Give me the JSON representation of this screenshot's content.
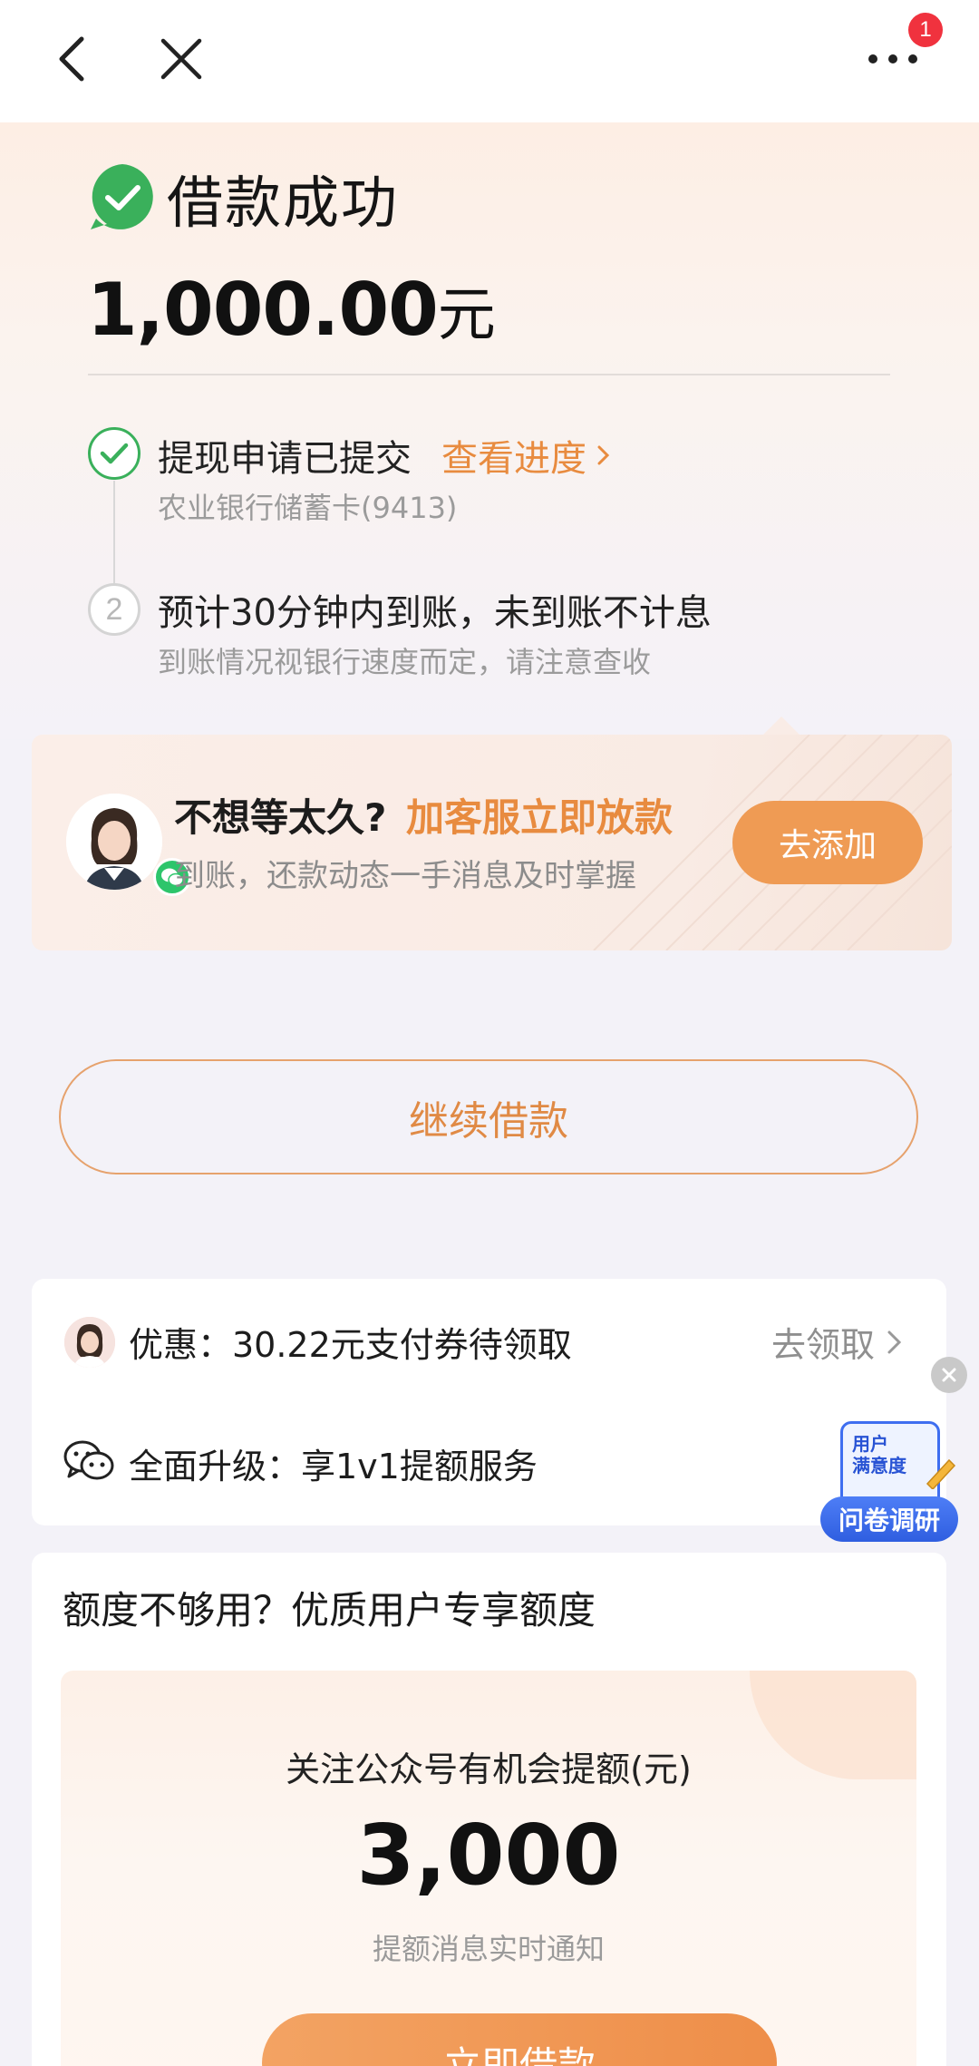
{
  "nav": {
    "back_icon": "chevron-left-icon",
    "close_icon": "close-icon",
    "more_icon": "more-horizontal-icon",
    "badge_count": "1"
  },
  "result": {
    "title": "借款成功",
    "amount": "1,000.00",
    "amount_unit": "元"
  },
  "steps": [
    {
      "title": "提现申请已提交",
      "link": "查看进度",
      "subtitle": "农业银行储蓄卡(9413)",
      "status": "done"
    },
    {
      "number": "2",
      "title": "预计30分钟内到账，未到账不计息",
      "subtitle": "到账情况视银行速度而定，请注意查收",
      "status": "pending"
    }
  ],
  "service_card": {
    "title": "不想等太久?",
    "highlight": "加客服立即放款",
    "subtitle": "到账，还款动态一手消息及时掌握",
    "button": "去添加"
  },
  "continue_button": "继续借款",
  "promos": [
    {
      "text": "优惠：30.22元支付券待领取",
      "action": "去领取"
    },
    {
      "text": "全面升级：享1v1提额服务"
    }
  ],
  "survey": {
    "doc_text_line1": "用户",
    "doc_text_line2": "满意度",
    "label": "问卷调研"
  },
  "limit_card": {
    "title": "额度不够用？优质用户专享额度",
    "subtitle": "关注公众号有机会提额(元)",
    "amount": "3,000",
    "note": "提额消息实时通知",
    "button": "立即借款"
  },
  "colors": {
    "accent": "#e88b3f",
    "success": "#3ab05b",
    "button": "#ef9b54",
    "survey": "#3e6ef0"
  }
}
